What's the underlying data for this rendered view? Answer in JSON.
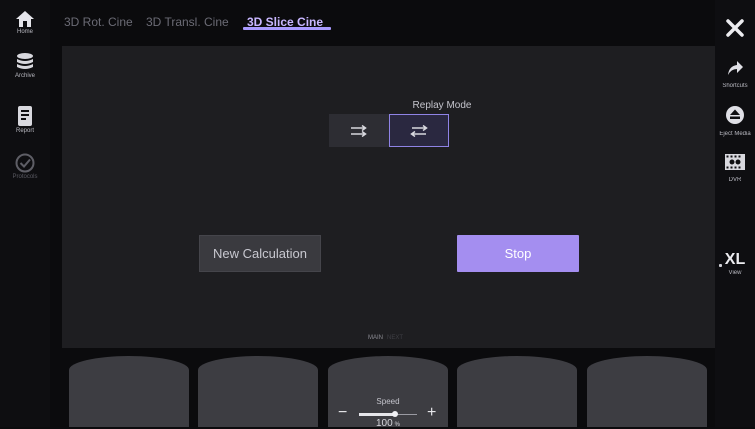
{
  "left_bar": {
    "items": [
      {
        "label": "Home",
        "icon": "home-icon"
      },
      {
        "label": "Archive",
        "icon": "database-icon"
      },
      {
        "label": "Report",
        "icon": "report-icon"
      },
      {
        "label": "Protocols",
        "icon": "check-circle-icon"
      }
    ]
  },
  "tabs": [
    {
      "label": "3D Rot. Cine"
    },
    {
      "label": "3D Transl. Cine"
    },
    {
      "label": "3D Slice Cine",
      "active": true
    }
  ],
  "right_bar": {
    "items": [
      {
        "label": "",
        "icon": "close-icon"
      },
      {
        "label": "Shortcuts",
        "icon": "share-arrow-icon"
      },
      {
        "label": "Eject Media",
        "icon": "eject-icon"
      },
      {
        "label": "DVR",
        "icon": "dvr-film-icon"
      },
      {
        "label": "View",
        "title": "XL"
      }
    ]
  },
  "main": {
    "replay_mode_label": "Replay Mode",
    "new_calculation_label": "New Calculation",
    "stop_label": "Stop",
    "page_indicator": "MAIN",
    "page_indicator_next": "NEXT"
  },
  "bottom": {
    "speed_label": "Speed",
    "speed_minus": "−",
    "speed_plus": "+",
    "speed_value": "100",
    "speed_unit": "%",
    "speed_level": 0.62
  },
  "colors": {
    "accent": "#a48ef0",
    "tab_active": "#c8b6ff",
    "panel": "#1e1e21",
    "background": "#0b0b0d"
  }
}
